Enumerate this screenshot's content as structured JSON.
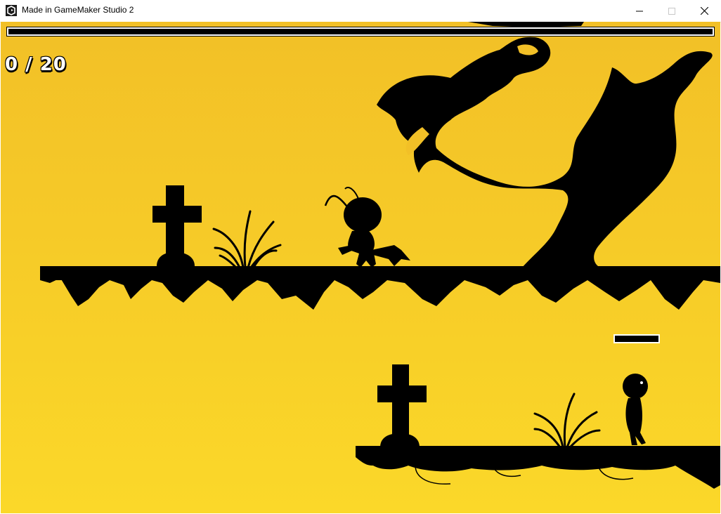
{
  "window": {
    "title": "Made in GameMaker Studio 2",
    "controls": {
      "minimize": "minimize-icon",
      "maximize": "maximize-icon",
      "close": "close-icon"
    }
  },
  "hud": {
    "counter_text": "0 / 20"
  },
  "colors": {
    "sky_top": "#f2c027",
    "sky_bottom": "#fbd829",
    "silhouette": "#000000",
    "hud_text": "#ffffff"
  }
}
